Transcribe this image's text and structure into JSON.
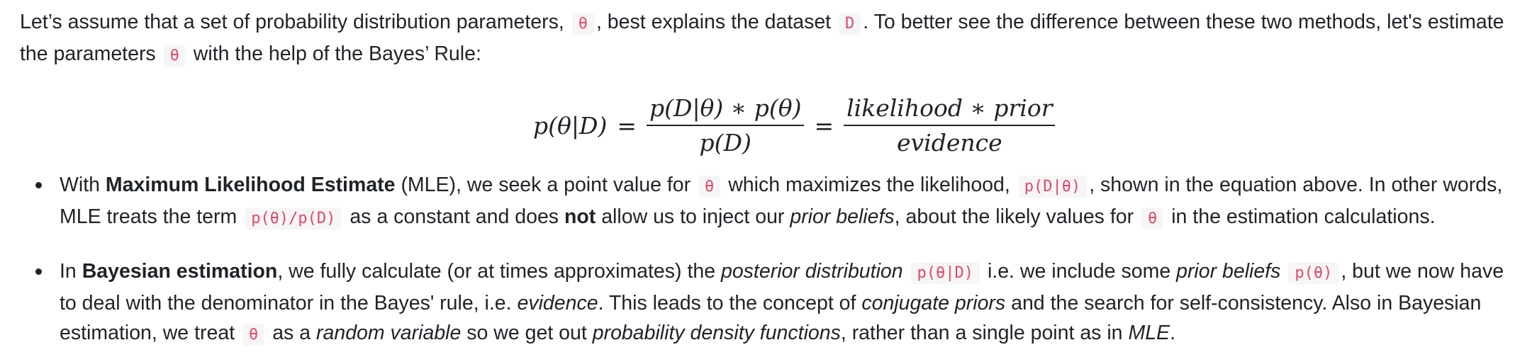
{
  "intro": {
    "t1": "Let’s assume that a set of probability distribution parameters,",
    "c1": "θ",
    "t2": ", best explains the dataset",
    "c2": "D",
    "t3": ". To better see the difference between these two methods, let's estimate the parameters",
    "c3": "θ",
    "t4": "with the help of the Bayes’ Rule:"
  },
  "equation": {
    "lhs": "p(θ|D)",
    "eq1": "=",
    "frac1_num": "p(D|θ) ∗ p(θ)",
    "frac1_den": "p(D)",
    "eq2": "=",
    "frac2_num": "likelihood ∗ prior",
    "frac2_den": "evidence"
  },
  "bullet1": {
    "t1": "With",
    "b1": "Maximum Likelihood Estimate",
    "t2": "(MLE), we seek a point value for",
    "c1": "θ",
    "t3": "which maximizes the likelihood,",
    "c2": "p(D|θ)",
    "t4": ", shown in the equation above. In other words, MLE treats the term",
    "c3": "p(θ)/p(D)",
    "t5": "as a constant and does",
    "b2": "not",
    "t6": "allow us to inject our",
    "i1": "prior beliefs",
    "t7": ", about the likely values for",
    "c4": "θ",
    "t8": "in the estimation calculations."
  },
  "bullet2": {
    "t1": "In",
    "b1": "Bayesian estimation",
    "t2": ", we fully calculate (or at times approximates) the",
    "i1": "posterior distribution",
    "c1": "p(θ|D)",
    "t3": "i.e. we include some",
    "i2": "prior beliefs",
    "c2": "p(θ)",
    "t4": ", but we now have to deal with the denominator in the Bayes' rule, i.e.",
    "i3": "evidence",
    "t5": ". This leads to the concept of",
    "i4": "conjugate priors",
    "t6": "and the search for self-consistency. Also in Bayesian estimation, we treat",
    "c3": "θ",
    "t7": "as a",
    "i5": "random variable",
    "t8": "so we get out",
    "i6": "probability density functions",
    "t9": ", rather than a single point as in",
    "i7": "MLE",
    "t10": "."
  }
}
